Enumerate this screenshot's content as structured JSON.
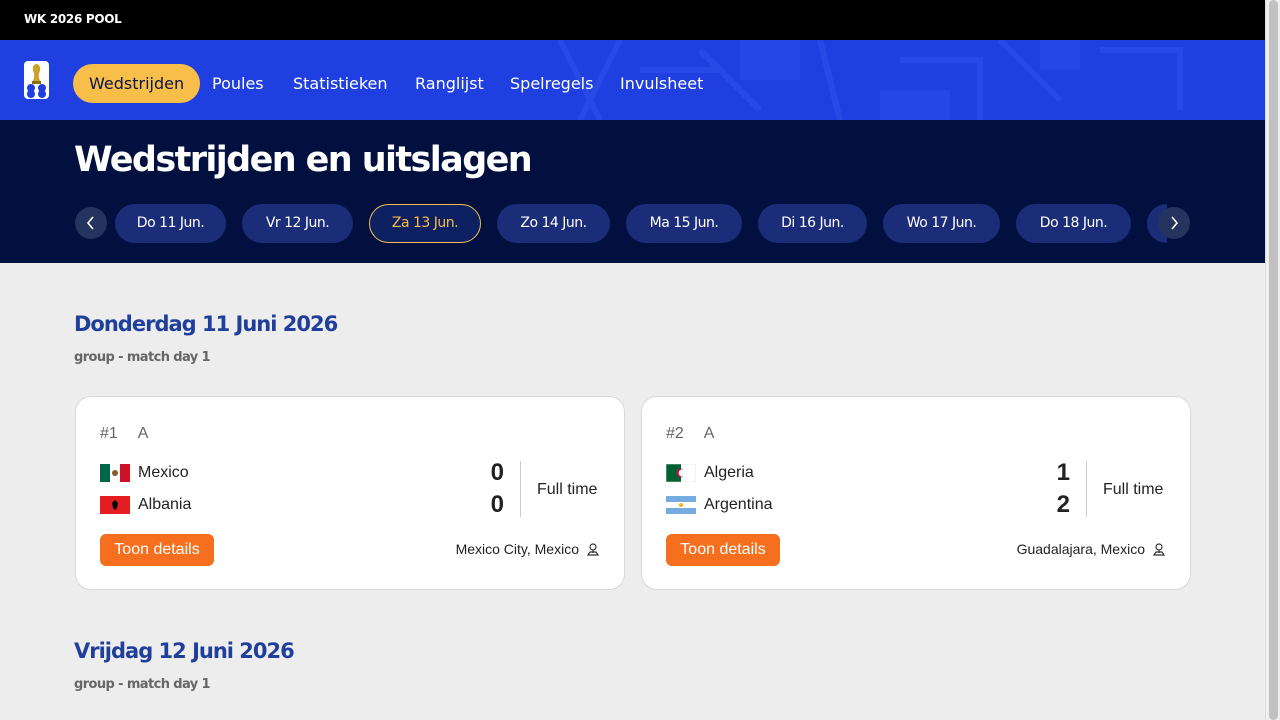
{
  "brand": "WK 2026 POOL",
  "nav": {
    "items": [
      {
        "label": "Wedstrijden",
        "active": true
      },
      {
        "label": "Poules"
      },
      {
        "label": "Statistieken"
      },
      {
        "label": "Ranglijst"
      },
      {
        "label": "Spelregels"
      },
      {
        "label": "Invulsheet"
      }
    ]
  },
  "page_title": "Wedstrijden en uitslagen",
  "dates": [
    {
      "label": "Do 11 Jun."
    },
    {
      "label": "Vr 12 Jun."
    },
    {
      "label": "Za 13 Jun.",
      "active": true
    },
    {
      "label": "Zo 14 Jun."
    },
    {
      "label": "Ma 15 Jun."
    },
    {
      "label": "Di 16 Jun."
    },
    {
      "label": "Wo 17 Jun."
    },
    {
      "label": "Do 18 Jun."
    }
  ],
  "days": [
    {
      "title": "Donderdag 11 Juni 2026",
      "subtitle": "group - match day 1",
      "matches": [
        {
          "number": "#1",
          "group": "A",
          "home": {
            "name": "Mexico",
            "score": "0"
          },
          "away": {
            "name": "Albania",
            "score": "0"
          },
          "status": "Full time",
          "details_label": "Toon details",
          "venue": "Mexico City, Mexico"
        },
        {
          "number": "#2",
          "group": "A",
          "home": {
            "name": "Algeria",
            "score": "1"
          },
          "away": {
            "name": "Argentina",
            "score": "2"
          },
          "status": "Full time",
          "details_label": "Toon details",
          "venue": "Guadalajara, Mexico"
        }
      ]
    },
    {
      "title": "Vrijdag 12 Juni 2026",
      "subtitle": "group - match day 1"
    }
  ],
  "colors": {
    "nav_bg": "#1f3fe0",
    "hero_bg": "#01103f",
    "accent": "#f7be4a",
    "button": "#f56f1e",
    "day_title": "#1f3f9a"
  },
  "icons": {
    "prev": "chevron-left-icon",
    "next": "chevron-right-icon",
    "venue": "location-pin-icon"
  }
}
